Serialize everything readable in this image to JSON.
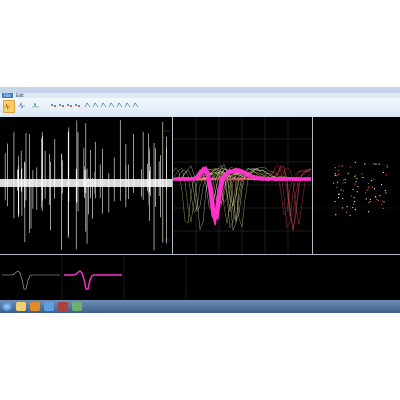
{
  "window": {
    "title": "",
    "menu": [
      "File",
      "Edit"
    ]
  },
  "ribbon": {
    "tools": [
      {
        "icon": "spike-select-icon",
        "active": true
      },
      {
        "icon": "waveform-icon",
        "active": false
      },
      {
        "icon": "threshold-icon",
        "active": false
      },
      {
        "icon": "cluster-icon",
        "active": false
      },
      {
        "icon": "cluster-icon",
        "active": false
      },
      {
        "icon": "cluster-icon",
        "active": false
      },
      {
        "icon": "cluster-icon",
        "active": false
      },
      {
        "icon": "cluster-icon",
        "active": false
      },
      {
        "icon": "cluster-icon",
        "active": false
      },
      {
        "icon": "cluster-icon",
        "active": false
      },
      {
        "icon": "cluster-icon",
        "active": false
      },
      {
        "icon": "cluster-icon",
        "active": false
      },
      {
        "icon": "cluster-icon",
        "active": false
      }
    ]
  },
  "panels": {
    "raw_trace": {
      "name": "raw-signal-panel",
      "trace_color": "#ffffff"
    },
    "spike_overlay": {
      "name": "spike-overlay-panel",
      "colors": [
        "#ff33cc",
        "#ffffff",
        "#e8e27a",
        "#ff5566"
      ]
    },
    "scatter": {
      "name": "cluster-scatter-panel",
      "colors": [
        "#ffffff",
        "#e8e27a",
        "#ff5566"
      ]
    },
    "templates": {
      "name": "template-strip",
      "colors": [
        "#bfbfbf",
        "#ff33cc"
      ]
    }
  },
  "taskbar": {
    "apps": [
      "start-orb",
      "explorer",
      "media-player",
      "app-3",
      "app-4",
      "app-5"
    ],
    "tray_time": "",
    "tray_date": ""
  },
  "colors": {
    "workspace_bg": "#000000",
    "ribbon_bg": "#dbe7f4",
    "taskbar_bg": "#3d5f8a",
    "accent": "#ff33cc"
  }
}
